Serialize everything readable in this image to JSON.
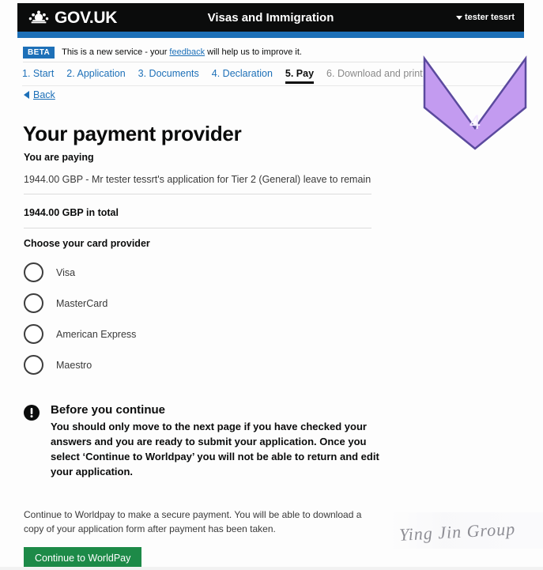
{
  "header": {
    "logo_text": "GOV.UK",
    "crown_icon": "crown-icon",
    "service_title": "Visas and Immigration",
    "user_name": "tester tessrt",
    "caret_icon": "caret-down-icon",
    "accent_blue": "#1d70b8",
    "bar_black": "#0b0c0c"
  },
  "beta_banner": {
    "tag": "BETA",
    "text_before": "This is a new service - your ",
    "link": "feedback",
    "text_after": " will help us to improve it."
  },
  "steps": [
    {
      "label": "1. Start",
      "state": "link"
    },
    {
      "label": "2. Application",
      "state": "link"
    },
    {
      "label": "3. Documents",
      "state": "link"
    },
    {
      "label": "4. Declaration",
      "state": "link"
    },
    {
      "label": "5. Pay",
      "state": "current"
    },
    {
      "label": "6. Download and print",
      "state": "muted"
    }
  ],
  "back": {
    "label": "Back",
    "icon": "back-arrow-icon"
  },
  "main": {
    "page_title": "Your payment provider",
    "you_are_paying_label": "You are paying",
    "payment_description": "1944.00 GBP - Mr tester tessrt's application for Tier 2 (General) leave to remain",
    "total_line": "1944.00 GBP in total",
    "choose_provider_label": "Choose your card provider",
    "card_providers": [
      {
        "label": "Visa",
        "selected": false
      },
      {
        "label": "MasterCard",
        "selected": false
      },
      {
        "label": "American Express",
        "selected": false
      },
      {
        "label": "Maestro",
        "selected": false
      }
    ]
  },
  "warning": {
    "icon": "exclamation-circle-icon",
    "title": "Before you continue",
    "body": "You should only move to the next page if you have checked your answers and you are ready to submit your application. Once you select ‘Continue to Worldpay’ you will not be able to return and edit your application."
  },
  "footer": {
    "copy": "Continue to Worldpay to make a secure payment. You will be able to download a copy of your application form after payment has been taken.",
    "cta_label": "Continue to WorldPay",
    "cta_color": "#1d8a48"
  },
  "annotation": {
    "number": "4",
    "fill": "#c39bf0",
    "stroke": "#5b4a9e"
  },
  "watermark": {
    "text": "Ying Jin Group"
  }
}
